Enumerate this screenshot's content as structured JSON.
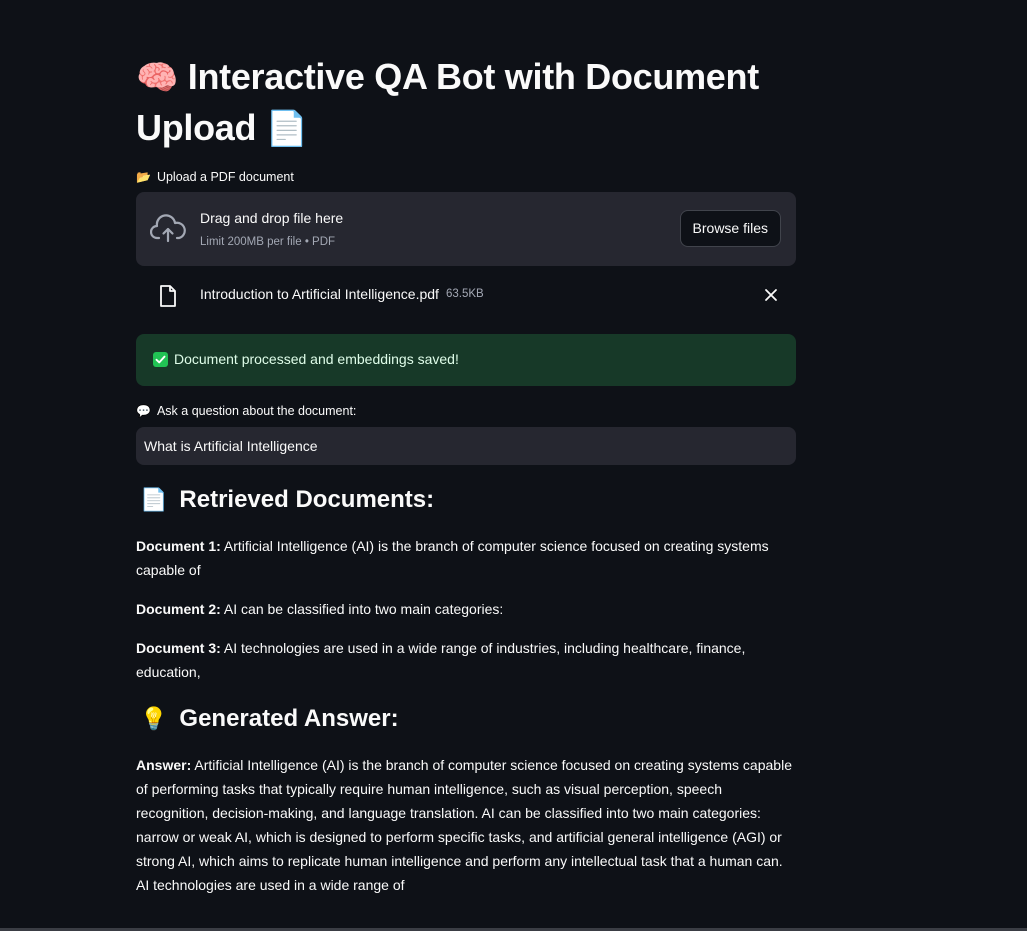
{
  "page": {
    "title_emoji": "🧠",
    "title": "Interactive QA Bot with Document Upload",
    "title_end_emoji": "📄"
  },
  "upload": {
    "label_emoji": "📂",
    "label": "Upload a PDF document",
    "drop_title": "Drag and drop file here",
    "limit": "Limit 200MB per file • PDF",
    "browse_label": "Browse files",
    "upload_icon": "cloud-upload-icon"
  },
  "file": {
    "name": "Introduction to Artificial Intelligence.pdf",
    "size": "63.5KB",
    "icon": "file-icon",
    "remove_icon": "close-icon"
  },
  "status": {
    "icon": "check-icon",
    "message": "Document processed and embeddings saved!",
    "bg_color": "#173928",
    "check_color": "#21c354"
  },
  "question": {
    "label_emoji": "💬",
    "label": "Ask a question about the document:",
    "value": "What is Artificial Intelligence"
  },
  "retrieved": {
    "emoji": "📄",
    "heading": "Retrieved Documents:",
    "documents": [
      {
        "label": "Document 1:",
        "text": " Artificial Intelligence (AI) is the branch of computer science focused on creating systems capable of"
      },
      {
        "label": "Document 2:",
        "text": " AI can be classified into two main categories:"
      },
      {
        "label": "Document 3:",
        "text": " AI technologies are used in a wide range of industries, including healthcare, finance, education,"
      }
    ]
  },
  "answer": {
    "emoji": "💡",
    "heading": "Generated Answer:",
    "label": "Answer:",
    "text": " Artificial Intelligence (AI) is the branch of computer science focused on creating systems capable of performing tasks that typically require human intelligence, such as visual perception, speech recognition, decision-making, and language translation. AI can be classified into two main categories: narrow or weak AI, which is designed to perform specific tasks, and artificial general intelligence (AGI) or strong AI, which aims to replicate human intelligence and perform any intellectual task that a human can. AI technologies are used in a wide range of"
  },
  "theme": {
    "background": "#0e1117",
    "surface": "#262730",
    "text": "#fafafa",
    "muted": "#a3a8b4"
  }
}
